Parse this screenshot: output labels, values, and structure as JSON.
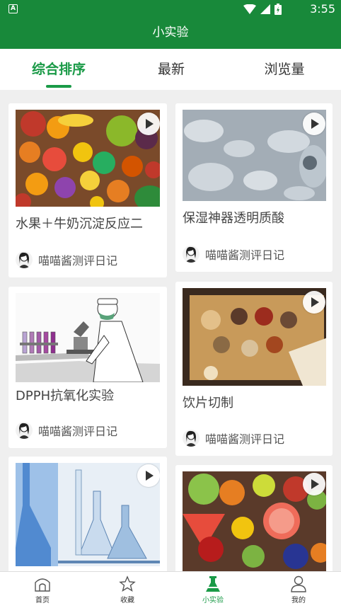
{
  "status_bar": {
    "time": "3:55",
    "notification_badge": "A"
  },
  "header": {
    "title": "小实验"
  },
  "tabs": [
    {
      "label": "综合排序",
      "active": true
    },
    {
      "label": "最新",
      "active": false
    },
    {
      "label": "浏览量",
      "active": false
    }
  ],
  "cards": [
    {
      "title": "水果＋牛奶沉淀反应二",
      "author": "喵喵酱测评日记",
      "has_video": true,
      "image": "fruit-assortment"
    },
    {
      "title": "保湿神器透明质酸",
      "author": "喵喵酱测评日记",
      "has_video": true,
      "image": "water-droplets"
    },
    {
      "title": "DPPH抗氧化实验",
      "author": "喵喵酱测评日记",
      "has_video": false,
      "image": "lab-scientist-illustration"
    },
    {
      "title": "饮片切制",
      "author": "喵喵酱测评日记",
      "has_video": true,
      "image": "herbal-medicine"
    },
    {
      "title": "",
      "author": "",
      "has_video": true,
      "image": "lab-glassware"
    },
    {
      "title": "",
      "author": "",
      "has_video": true,
      "image": "fruit-assortment-2"
    }
  ],
  "bottom_nav": [
    {
      "label": "首页",
      "icon": "home-icon",
      "active": false
    },
    {
      "label": "收藏",
      "icon": "star-icon",
      "active": false
    },
    {
      "label": "小实验",
      "icon": "flask-icon",
      "active": true
    },
    {
      "label": "我的",
      "icon": "person-icon",
      "active": false
    }
  ],
  "colors": {
    "primary": "#18893a",
    "accent": "#1a9a47",
    "background": "#efefef"
  }
}
